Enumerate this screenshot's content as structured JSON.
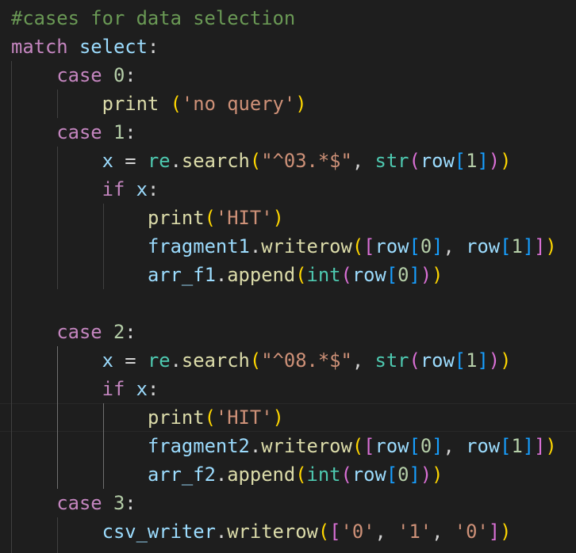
{
  "editor": {
    "theme": "dark",
    "colors": {
      "background": "#1e1e1e",
      "comment": "#6a9955",
      "keyword": "#c586c0",
      "variable": "#9cdcfe",
      "function": "#dcdcaa",
      "number": "#b5cea8",
      "string": "#ce9178",
      "builtin": "#4ec9b0",
      "bracket_level1": "#ffd700",
      "bracket_level2": "#da70d6",
      "bracket_level3": "#179fff"
    },
    "lines": [
      [
        {
          "t": "#cases for data selection",
          "c": "comment"
        }
      ],
      [
        {
          "t": "match",
          "c": "keyword"
        },
        {
          "t": " ",
          "c": "plain"
        },
        {
          "t": "select",
          "c": "var"
        },
        {
          "t": ":",
          "c": "plain"
        }
      ],
      [
        {
          "t": "    ",
          "c": "plain"
        },
        {
          "t": "case",
          "c": "keyword"
        },
        {
          "t": " ",
          "c": "plain"
        },
        {
          "t": "0",
          "c": "num"
        },
        {
          "t": ":",
          "c": "plain"
        }
      ],
      [
        {
          "t": "        ",
          "c": "plain"
        },
        {
          "t": "print",
          "c": "func"
        },
        {
          "t": " ",
          "c": "plain"
        },
        {
          "t": "(",
          "c": "br1"
        },
        {
          "t": "'no query'",
          "c": "str"
        },
        {
          "t": ")",
          "c": "br1"
        }
      ],
      [
        {
          "t": "    ",
          "c": "plain"
        },
        {
          "t": "case",
          "c": "keyword"
        },
        {
          "t": " ",
          "c": "plain"
        },
        {
          "t": "1",
          "c": "num"
        },
        {
          "t": ":",
          "c": "plain"
        }
      ],
      [
        {
          "t": "        ",
          "c": "plain"
        },
        {
          "t": "x",
          "c": "var"
        },
        {
          "t": " = ",
          "c": "plain"
        },
        {
          "t": "re",
          "c": "class"
        },
        {
          "t": ".",
          "c": "plain"
        },
        {
          "t": "search",
          "c": "func"
        },
        {
          "t": "(",
          "c": "br1"
        },
        {
          "t": "\"^03.*$\"",
          "c": "str"
        },
        {
          "t": ", ",
          "c": "plain"
        },
        {
          "t": "str",
          "c": "class"
        },
        {
          "t": "(",
          "c": "br2"
        },
        {
          "t": "row",
          "c": "var"
        },
        {
          "t": "[",
          "c": "br3"
        },
        {
          "t": "1",
          "c": "num"
        },
        {
          "t": "]",
          "c": "br3"
        },
        {
          "t": ")",
          "c": "br2"
        },
        {
          "t": ")",
          "c": "br1"
        }
      ],
      [
        {
          "t": "        ",
          "c": "plain"
        },
        {
          "t": "if",
          "c": "keyword"
        },
        {
          "t": " ",
          "c": "plain"
        },
        {
          "t": "x",
          "c": "var"
        },
        {
          "t": ":",
          "c": "plain"
        }
      ],
      [
        {
          "t": "            ",
          "c": "plain"
        },
        {
          "t": "print",
          "c": "func"
        },
        {
          "t": "(",
          "c": "br1"
        },
        {
          "t": "'HIT'",
          "c": "str"
        },
        {
          "t": ")",
          "c": "br1"
        }
      ],
      [
        {
          "t": "            ",
          "c": "plain"
        },
        {
          "t": "fragment1",
          "c": "var"
        },
        {
          "t": ".",
          "c": "plain"
        },
        {
          "t": "writerow",
          "c": "func"
        },
        {
          "t": "(",
          "c": "br1"
        },
        {
          "t": "[",
          "c": "br2"
        },
        {
          "t": "row",
          "c": "var"
        },
        {
          "t": "[",
          "c": "br3"
        },
        {
          "t": "0",
          "c": "num"
        },
        {
          "t": "]",
          "c": "br3"
        },
        {
          "t": ", ",
          "c": "plain"
        },
        {
          "t": "row",
          "c": "var"
        },
        {
          "t": "[",
          "c": "br3"
        },
        {
          "t": "1",
          "c": "num"
        },
        {
          "t": "]",
          "c": "br3"
        },
        {
          "t": "]",
          "c": "br2"
        },
        {
          "t": ")",
          "c": "br1"
        }
      ],
      [
        {
          "t": "            ",
          "c": "plain"
        },
        {
          "t": "arr_f1",
          "c": "var"
        },
        {
          "t": ".",
          "c": "plain"
        },
        {
          "t": "append",
          "c": "func"
        },
        {
          "t": "(",
          "c": "br1"
        },
        {
          "t": "int",
          "c": "class"
        },
        {
          "t": "(",
          "c": "br2"
        },
        {
          "t": "row",
          "c": "var"
        },
        {
          "t": "[",
          "c": "br3"
        },
        {
          "t": "0",
          "c": "num"
        },
        {
          "t": "]",
          "c": "br3"
        },
        {
          "t": ")",
          "c": "br2"
        },
        {
          "t": ")",
          "c": "br1"
        }
      ],
      [],
      [
        {
          "t": "    ",
          "c": "plain"
        },
        {
          "t": "case",
          "c": "keyword"
        },
        {
          "t": " ",
          "c": "plain"
        },
        {
          "t": "2",
          "c": "num"
        },
        {
          "t": ":",
          "c": "plain"
        }
      ],
      [
        {
          "t": "        ",
          "c": "plain"
        },
        {
          "t": "x",
          "c": "var"
        },
        {
          "t": " = ",
          "c": "plain"
        },
        {
          "t": "re",
          "c": "class"
        },
        {
          "t": ".",
          "c": "plain"
        },
        {
          "t": "search",
          "c": "func"
        },
        {
          "t": "(",
          "c": "br1"
        },
        {
          "t": "\"^08.*$\"",
          "c": "str"
        },
        {
          "t": ", ",
          "c": "plain"
        },
        {
          "t": "str",
          "c": "class"
        },
        {
          "t": "(",
          "c": "br2"
        },
        {
          "t": "row",
          "c": "var"
        },
        {
          "t": "[",
          "c": "br3"
        },
        {
          "t": "1",
          "c": "num"
        },
        {
          "t": "]",
          "c": "br3"
        },
        {
          "t": ")",
          "c": "br2"
        },
        {
          "t": ")",
          "c": "br1"
        }
      ],
      [
        {
          "t": "        ",
          "c": "plain"
        },
        {
          "t": "if",
          "c": "keyword"
        },
        {
          "t": " ",
          "c": "plain"
        },
        {
          "t": "x",
          "c": "var"
        },
        {
          "t": ":",
          "c": "plain"
        }
      ],
      [
        {
          "t": "            ",
          "c": "plain"
        },
        {
          "t": "print",
          "c": "func"
        },
        {
          "t": "(",
          "c": "br1"
        },
        {
          "t": "'HIT'",
          "c": "str"
        },
        {
          "t": ")",
          "c": "br1"
        }
      ],
      [
        {
          "t": "            ",
          "c": "plain"
        },
        {
          "t": "fragment2",
          "c": "var"
        },
        {
          "t": ".",
          "c": "plain"
        },
        {
          "t": "writerow",
          "c": "func"
        },
        {
          "t": "(",
          "c": "br1"
        },
        {
          "t": "[",
          "c": "br2"
        },
        {
          "t": "row",
          "c": "var"
        },
        {
          "t": "[",
          "c": "br3"
        },
        {
          "t": "0",
          "c": "num"
        },
        {
          "t": "]",
          "c": "br3"
        },
        {
          "t": ", ",
          "c": "plain"
        },
        {
          "t": "row",
          "c": "var"
        },
        {
          "t": "[",
          "c": "br3"
        },
        {
          "t": "1",
          "c": "num"
        },
        {
          "t": "]",
          "c": "br3"
        },
        {
          "t": "]",
          "c": "br2"
        },
        {
          "t": ")",
          "c": "br1"
        }
      ],
      [
        {
          "t": "            ",
          "c": "plain"
        },
        {
          "t": "arr_f2",
          "c": "var"
        },
        {
          "t": ".",
          "c": "plain"
        },
        {
          "t": "append",
          "c": "func"
        },
        {
          "t": "(",
          "c": "br1"
        },
        {
          "t": "int",
          "c": "class"
        },
        {
          "t": "(",
          "c": "br2"
        },
        {
          "t": "row",
          "c": "var"
        },
        {
          "t": "[",
          "c": "br3"
        },
        {
          "t": "0",
          "c": "num"
        },
        {
          "t": "]",
          "c": "br3"
        },
        {
          "t": ")",
          "c": "br2"
        },
        {
          "t": ")",
          "c": "br1"
        }
      ],
      [
        {
          "t": "    ",
          "c": "plain"
        },
        {
          "t": "case",
          "c": "keyword"
        },
        {
          "t": " ",
          "c": "plain"
        },
        {
          "t": "3",
          "c": "num"
        },
        {
          "t": ":",
          "c": "plain"
        }
      ],
      [
        {
          "t": "        ",
          "c": "plain"
        },
        {
          "t": "csv_writer",
          "c": "var"
        },
        {
          "t": ".",
          "c": "plain"
        },
        {
          "t": "writerow",
          "c": "func"
        },
        {
          "t": "(",
          "c": "br1"
        },
        {
          "t": "[",
          "c": "br2"
        },
        {
          "t": "'0'",
          "c": "str"
        },
        {
          "t": ", ",
          "c": "plain"
        },
        {
          "t": "'1'",
          "c": "str"
        },
        {
          "t": ", ",
          "c": "plain"
        },
        {
          "t": "'0'",
          "c": "str"
        },
        {
          "t": "]",
          "c": "br2"
        },
        {
          "t": ")",
          "c": "br1"
        }
      ]
    ]
  }
}
